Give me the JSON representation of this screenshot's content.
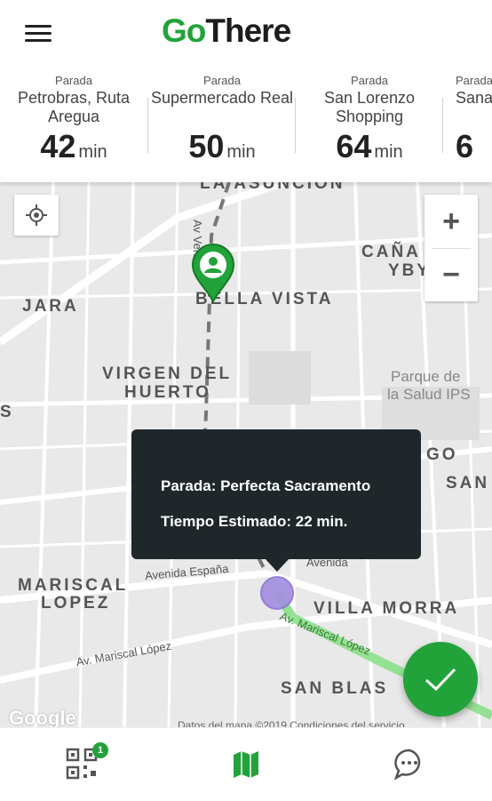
{
  "app": {
    "logo_part1": "Go",
    "logo_part2": "There"
  },
  "stops": [
    {
      "caption": "Parada",
      "name": "Petrobras, Ruta Aregua",
      "minutes": "42",
      "unit": "min"
    },
    {
      "caption": "Parada",
      "name": "Supermercado Real",
      "minutes": "50",
      "unit": "min"
    },
    {
      "caption": "Parada",
      "name": "San Lorenzo Shopping",
      "minutes": "64",
      "unit": "min"
    },
    {
      "caption": "Parada",
      "name": "Sana",
      "minutes": "6",
      "unit": ""
    }
  ],
  "map": {
    "labels": {
      "la_asuncion": "LA ASUNCION",
      "bella_vista": "BELLA VISTA",
      "jara": "JARA",
      "virgen_del_huerto_1": "VIRGEN DEL",
      "virgen_del_huerto_2": "HUERTO",
      "canada_1": "CAÑA",
      "canada_2": "YBY",
      "parque_1": "Parque de",
      "parque_2": "la Salud IPS",
      "mariscal_lopez_1": "MARISCAL",
      "mariscal_lopez_2": "LOPEZ",
      "villa_morra": "VILLA MORRA",
      "san_blas": "SAN BLAS",
      "san_right": "SAN",
      "go_right": "GO",
      "s_left": "S",
      "av_venezuela": "Av Vene",
      "avenida_espana": "Avenida España",
      "av_mariscal_lopez_1": "Av. Mariscal López",
      "av_mariscal_lopez_2": "Av. Mariscal López",
      "avenida_right": "Avenida"
    },
    "google": "Google",
    "credits": "Datos del mapa ©2019    Condiciones del servicio"
  },
  "popup": {
    "line1": "Parada: Perfecta Sacramento",
    "line2": "Tiempo Estimado: 22 min."
  },
  "zoom": {
    "in": "+",
    "out": "−"
  },
  "nav": {
    "qr_badge": "1"
  },
  "colors": {
    "brand": "#22a33a",
    "popup_bg": "#1f272b",
    "route": "#8be08b",
    "user_dot": "#a38ee0"
  }
}
